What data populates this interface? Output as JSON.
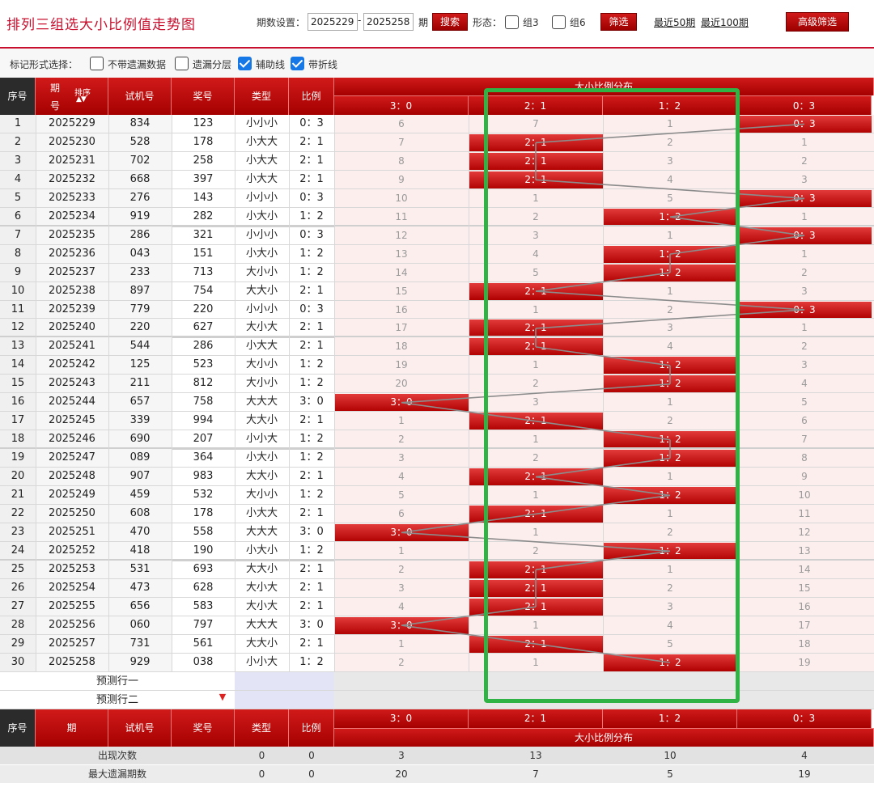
{
  "title": "排列三组选大小比例值走势图",
  "toolbar": {
    "period_label": "期数设置：",
    "start_period": "2025229",
    "end_period": "2025258",
    "qi": "期",
    "search_label": "搜索",
    "form_label": "形态：",
    "zu3_label": "组3",
    "zu6_label": "组6",
    "filter_label": "筛选",
    "recent50": "最近50期",
    "recent100": "最近100期",
    "advanced_label": "高级筛选"
  },
  "options": {
    "label": "标记形式选择：",
    "items": [
      {
        "label": "不带遗漏数据",
        "checked": false
      },
      {
        "label": "遗漏分层",
        "checked": false
      },
      {
        "label": "辅助线",
        "checked": true
      },
      {
        "label": "带折线",
        "checked": true
      }
    ]
  },
  "header": {
    "seq": "序号",
    "period_a": "期",
    "period_b": "号",
    "sort_label": "排序",
    "trial": "试机号",
    "prize": "奖号",
    "type": "类型",
    "ratio": "比例",
    "dist_title": "大小比例分布",
    "dist_cols": [
      "3：0",
      "2：1",
      "1：2",
      "0：3"
    ]
  },
  "rows": [
    {
      "seq": "1",
      "period": "2025229",
      "trial": "834",
      "prize": "123",
      "type": "小小小",
      "ratio": "0：3",
      "hit": 3,
      "miss": [
        "6",
        "7",
        "1",
        ""
      ]
    },
    {
      "seq": "2",
      "period": "2025230",
      "trial": "528",
      "prize": "178",
      "type": "小大大",
      "ratio": "2：1",
      "hit": 1,
      "miss": [
        "7",
        "",
        "2",
        "1"
      ]
    },
    {
      "seq": "3",
      "period": "2025231",
      "trial": "702",
      "prize": "258",
      "type": "小大大",
      "ratio": "2：1",
      "hit": 1,
      "miss": [
        "8",
        "",
        "3",
        "2"
      ]
    },
    {
      "seq": "4",
      "period": "2025232",
      "trial": "668",
      "prize": "397",
      "type": "小大大",
      "ratio": "2：1",
      "hit": 1,
      "miss": [
        "9",
        "",
        "4",
        "3"
      ]
    },
    {
      "seq": "5",
      "period": "2025233",
      "trial": "276",
      "prize": "143",
      "type": "小小小",
      "ratio": "0：3",
      "hit": 3,
      "miss": [
        "10",
        "1",
        "5",
        ""
      ]
    },
    {
      "seq": "6",
      "period": "2025234",
      "trial": "919",
      "prize": "282",
      "type": "小大小",
      "ratio": "1：2",
      "hit": 2,
      "miss": [
        "11",
        "2",
        "",
        "1"
      ]
    },
    {
      "seq": "7",
      "period": "2025235",
      "trial": "286",
      "prize": "321",
      "type": "小小小",
      "ratio": "0：3",
      "hit": 3,
      "miss": [
        "12",
        "3",
        "1",
        ""
      ]
    },
    {
      "seq": "8",
      "period": "2025236",
      "trial": "043",
      "prize": "151",
      "type": "小大小",
      "ratio": "1：2",
      "hit": 2,
      "miss": [
        "13",
        "4",
        "",
        "1"
      ]
    },
    {
      "seq": "9",
      "period": "2025237",
      "trial": "233",
      "prize": "713",
      "type": "大小小",
      "ratio": "1：2",
      "hit": 2,
      "miss": [
        "14",
        "5",
        "",
        "2"
      ]
    },
    {
      "seq": "10",
      "period": "2025238",
      "trial": "897",
      "prize": "754",
      "type": "大大小",
      "ratio": "2：1",
      "hit": 1,
      "miss": [
        "15",
        "",
        "1",
        "3"
      ]
    },
    {
      "seq": "11",
      "period": "2025239",
      "trial": "779",
      "prize": "220",
      "type": "小小小",
      "ratio": "0：3",
      "hit": 3,
      "miss": [
        "16",
        "1",
        "2",
        ""
      ]
    },
    {
      "seq": "12",
      "period": "2025240",
      "trial": "220",
      "prize": "627",
      "type": "大小大",
      "ratio": "2：1",
      "hit": 1,
      "miss": [
        "17",
        "",
        "3",
        "1"
      ]
    },
    {
      "seq": "13",
      "period": "2025241",
      "trial": "544",
      "prize": "286",
      "type": "小大大",
      "ratio": "2：1",
      "hit": 1,
      "miss": [
        "18",
        "",
        "4",
        "2"
      ]
    },
    {
      "seq": "14",
      "period": "2025242",
      "trial": "125",
      "prize": "523",
      "type": "大小小",
      "ratio": "1：2",
      "hit": 2,
      "miss": [
        "19",
        "1",
        "",
        "3"
      ]
    },
    {
      "seq": "15",
      "period": "2025243",
      "trial": "211",
      "prize": "812",
      "type": "大小小",
      "ratio": "1：2",
      "hit": 2,
      "miss": [
        "20",
        "2",
        "",
        "4"
      ]
    },
    {
      "seq": "16",
      "period": "2025244",
      "trial": "657",
      "prize": "758",
      "type": "大大大",
      "ratio": "3：0",
      "hit": 0,
      "miss": [
        "",
        "3",
        "1",
        "5"
      ]
    },
    {
      "seq": "17",
      "period": "2025245",
      "trial": "339",
      "prize": "994",
      "type": "大大小",
      "ratio": "2：1",
      "hit": 1,
      "miss": [
        "1",
        "",
        "2",
        "6"
      ]
    },
    {
      "seq": "18",
      "period": "2025246",
      "trial": "690",
      "prize": "207",
      "type": "小小大",
      "ratio": "1：2",
      "hit": 2,
      "miss": [
        "2",
        "1",
        "",
        "7"
      ]
    },
    {
      "seq": "19",
      "period": "2025247",
      "trial": "089",
      "prize": "364",
      "type": "小大小",
      "ratio": "1：2",
      "hit": 2,
      "miss": [
        "3",
        "2",
        "",
        "8"
      ]
    },
    {
      "seq": "20",
      "period": "2025248",
      "trial": "907",
      "prize": "983",
      "type": "大大小",
      "ratio": "2：1",
      "hit": 1,
      "miss": [
        "4",
        "",
        "1",
        "9"
      ]
    },
    {
      "seq": "21",
      "period": "2025249",
      "trial": "459",
      "prize": "532",
      "type": "大小小",
      "ratio": "1：2",
      "hit": 2,
      "miss": [
        "5",
        "1",
        "",
        "10"
      ]
    },
    {
      "seq": "22",
      "period": "2025250",
      "trial": "608",
      "prize": "178",
      "type": "小大大",
      "ratio": "2：1",
      "hit": 1,
      "miss": [
        "6",
        "",
        "1",
        "11"
      ]
    },
    {
      "seq": "23",
      "period": "2025251",
      "trial": "470",
      "prize": "558",
      "type": "大大大",
      "ratio": "3：0",
      "hit": 0,
      "miss": [
        "",
        "1",
        "2",
        "12"
      ]
    },
    {
      "seq": "24",
      "period": "2025252",
      "trial": "418",
      "prize": "190",
      "type": "小大小",
      "ratio": "1：2",
      "hit": 2,
      "miss": [
        "1",
        "2",
        "",
        "13"
      ]
    },
    {
      "seq": "25",
      "period": "2025253",
      "trial": "531",
      "prize": "693",
      "type": "大大小",
      "ratio": "2：1",
      "hit": 1,
      "miss": [
        "2",
        "",
        "1",
        "14"
      ]
    },
    {
      "seq": "26",
      "period": "2025254",
      "trial": "473",
      "prize": "628",
      "type": "大小大",
      "ratio": "2：1",
      "hit": 1,
      "miss": [
        "3",
        "",
        "2",
        "15"
      ]
    },
    {
      "seq": "27",
      "period": "2025255",
      "trial": "656",
      "prize": "583",
      "type": "大小大",
      "ratio": "2：1",
      "hit": 1,
      "miss": [
        "4",
        "",
        "3",
        "16"
      ]
    },
    {
      "seq": "28",
      "period": "2025256",
      "trial": "060",
      "prize": "797",
      "type": "大大大",
      "ratio": "3：0",
      "hit": 0,
      "miss": [
        "",
        "1",
        "4",
        "17"
      ]
    },
    {
      "seq": "29",
      "period": "2025257",
      "trial": "731",
      "prize": "561",
      "type": "大大小",
      "ratio": "2：1",
      "hit": 1,
      "miss": [
        "1",
        "",
        "5",
        "18"
      ]
    },
    {
      "seq": "30",
      "period": "2025258",
      "trial": "929",
      "prize": "038",
      "type": "小小大",
      "ratio": "1：2",
      "hit": 2,
      "miss": [
        "2",
        "1",
        "",
        "19"
      ]
    }
  ],
  "predict": [
    "预测行一",
    "预测行二"
  ],
  "stats": [
    {
      "label": "出现次数",
      "type": "0",
      "ratio": "0",
      "values": [
        "3",
        "13",
        "10",
        "4"
      ]
    },
    {
      "label": "最大遗漏期数",
      "type": "0",
      "ratio": "0",
      "values": [
        "20",
        "7",
        "5",
        "19"
      ]
    }
  ],
  "colors": {
    "accent": "#c8102e",
    "highlight": "#2fb344",
    "hit": "#b00000"
  }
}
